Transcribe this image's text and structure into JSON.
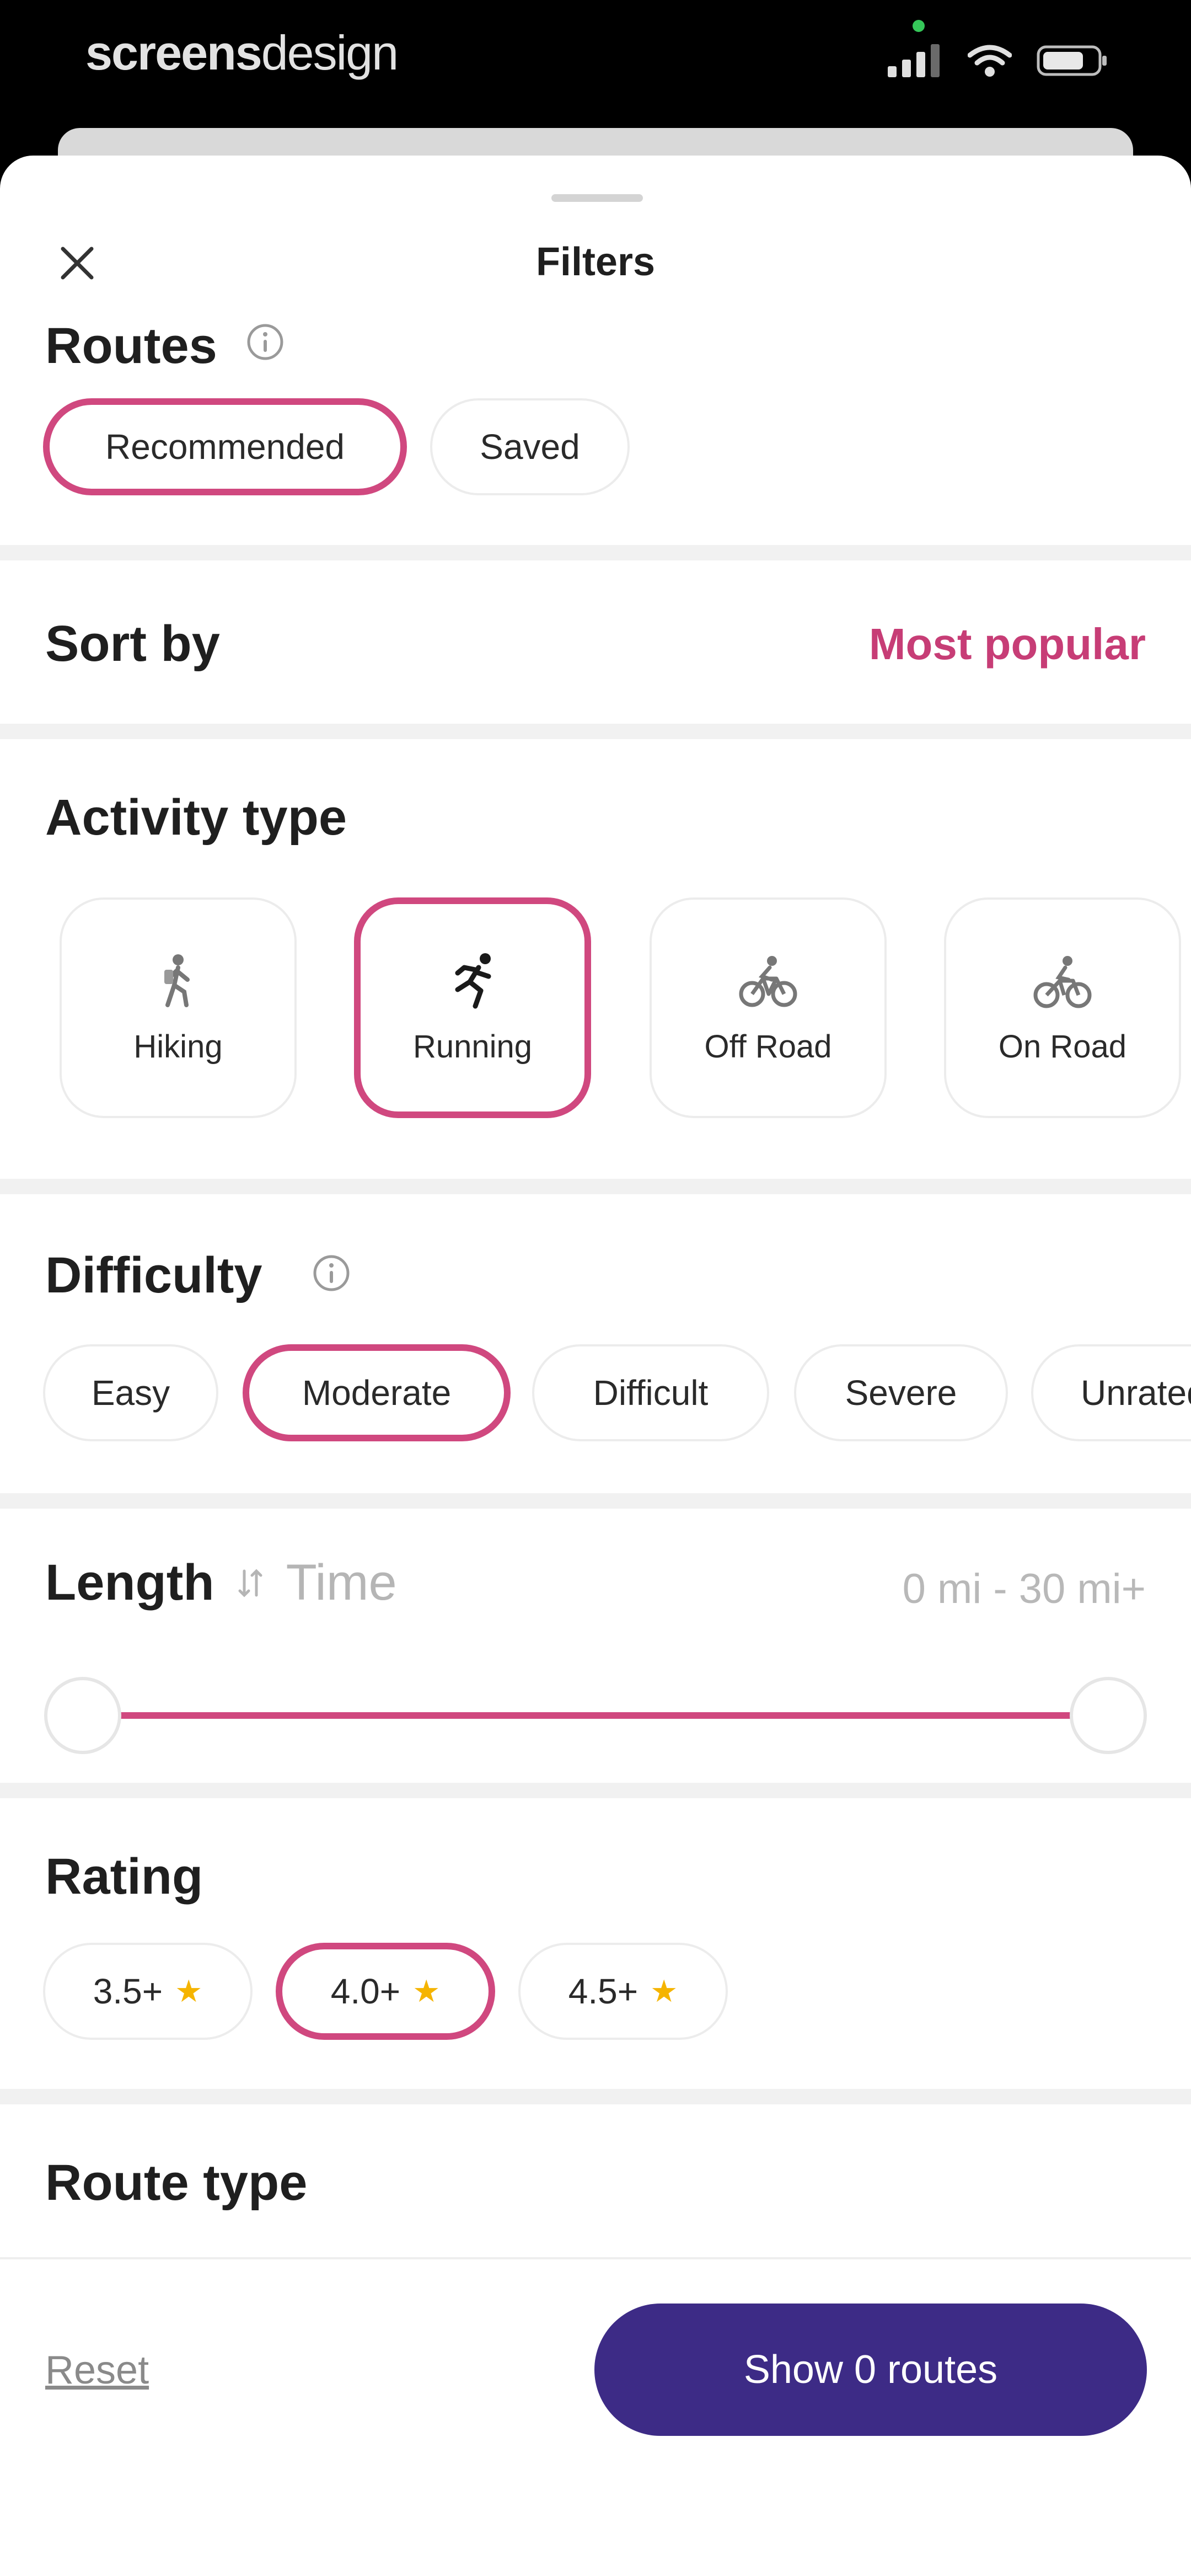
{
  "status_bar": {
    "brand_bold": "screens",
    "brand_light": "design",
    "icons": [
      "cellular-signal-icon",
      "wifi-icon",
      "battery-icon"
    ]
  },
  "sheet": {
    "title": "Filters",
    "close_icon": "close-icon"
  },
  "routes": {
    "title": "Routes",
    "options": [
      "Recommended",
      "Saved"
    ],
    "selected": "Recommended"
  },
  "sort": {
    "title": "Sort by",
    "value": "Most popular"
  },
  "activity": {
    "title": "Activity type",
    "options": [
      {
        "label": "Hiking",
        "icon": "hiking-icon"
      },
      {
        "label": "Running",
        "icon": "running-icon"
      },
      {
        "label": "Off Road",
        "icon": "off-road-bike-icon"
      },
      {
        "label": "On Road",
        "icon": "road-bike-icon"
      }
    ],
    "selected": "Running"
  },
  "difficulty": {
    "title": "Difficulty",
    "options": [
      "Easy",
      "Moderate",
      "Difficult",
      "Severe",
      "Unrated"
    ],
    "selected": "Moderate"
  },
  "length": {
    "title": "Length",
    "alt_title": "Time",
    "range_text": "0 mi - 30 mi+",
    "range_min_value": 0,
    "range_max_value": 1
  },
  "rating": {
    "title": "Rating",
    "options": [
      "3.5+",
      "4.0+",
      "4.5+"
    ],
    "selected": "4.0+"
  },
  "route_type": {
    "title": "Route type"
  },
  "footer": {
    "reset_label": "Reset",
    "show_label": "Show 0 routes"
  },
  "colors": {
    "accent": "#d0487f",
    "primary_button": "#3d2b86",
    "star": "#f5b400"
  }
}
